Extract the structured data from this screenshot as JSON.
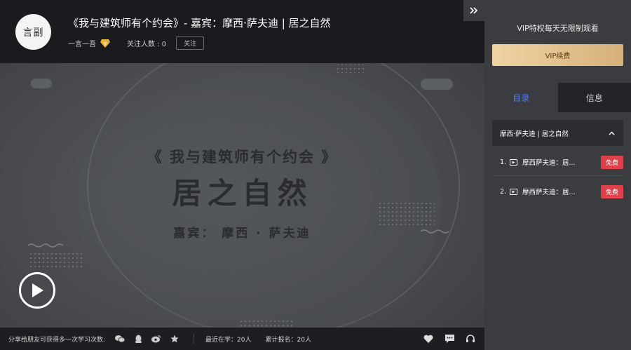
{
  "header": {
    "avatar_text": "言副",
    "title": "《我与建筑师有个约会》- 嘉宾：摩西·萨夫迪 | 居之自然",
    "author": "一言一吾",
    "followers_label": "关注人数 : 0",
    "follow_button": "关注"
  },
  "video": {
    "cover_line1": "《 我与建筑师有个约会 》",
    "cover_line2": "居之自然",
    "cover_line3": "嘉宾：  摩西 · 萨夫迪"
  },
  "bottom_bar": {
    "share_text": "分享给朋友可获得多一次学习次数:",
    "recent_learning": "最近在学：20人",
    "total_signups": "累计报名：20人",
    "share_icons": [
      "wechat-icon",
      "qq-icon",
      "weibo-icon",
      "star-icon"
    ],
    "action_icons": [
      "heart-icon",
      "comment-icon",
      "headset-icon"
    ]
  },
  "sidebar": {
    "collapse_icon": "double-chevron-right-icon",
    "vip_text": "VIP特权每天无限制观看",
    "vip_button": "VIP续费",
    "tabs": [
      {
        "label": "目录",
        "active": true
      },
      {
        "label": "信息",
        "active": false
      }
    ],
    "chapter_title": "摩西·萨夫迪 | 居之自然",
    "lessons": [
      {
        "index": "1.",
        "name": "摩西萨夫迪：居...",
        "badge": "免费"
      },
      {
        "index": "2.",
        "name": "摩西萨夫迪：居...",
        "badge": "免费"
      }
    ]
  },
  "colors": {
    "accent_blue": "#4d7cf5",
    "vip_gold": "#d6b07a",
    "free_badge_red": "#e0404a",
    "panel_bg": "#3a3c3f",
    "header_bg": "#1a1b1e"
  }
}
